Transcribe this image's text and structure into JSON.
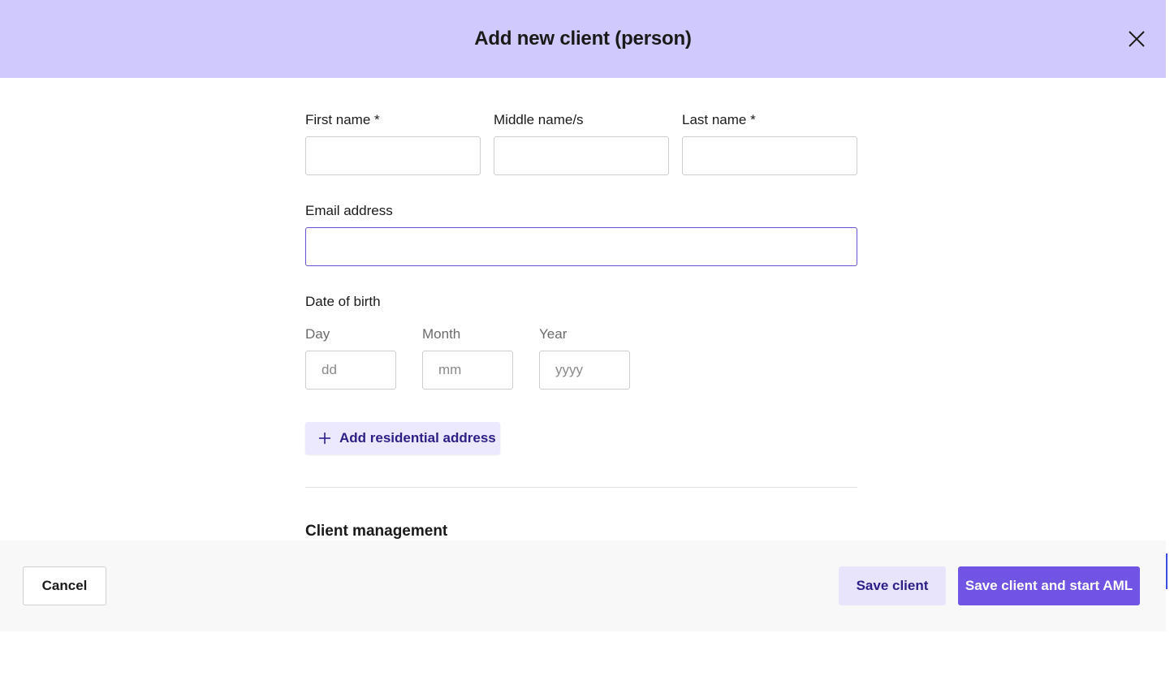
{
  "header": {
    "title": "Add new client (person)"
  },
  "fields": {
    "first_name": {
      "label": "First name *",
      "value": ""
    },
    "middle_name": {
      "label": "Middle name/s",
      "value": ""
    },
    "last_name": {
      "label": "Last name *",
      "value": ""
    },
    "email": {
      "label": "Email address",
      "value": ""
    }
  },
  "dob": {
    "label": "Date of birth",
    "day": {
      "label": "Day",
      "placeholder": "dd"
    },
    "month": {
      "label": "Month",
      "placeholder": "mm"
    },
    "year": {
      "label": "Year",
      "placeholder": "yyyy"
    }
  },
  "add_address_label": "Add residential address",
  "section": {
    "title": "Client management"
  },
  "footer": {
    "cancel_label": "Cancel",
    "save_label": "Save client",
    "save_aml_label": "Save client and start AML"
  },
  "colors": {
    "header_bg": "#d0c9fd",
    "primary": "#7154e3",
    "secondary_bg": "#e8e4fc",
    "focus_border": "#6a4fd0"
  },
  "icons": {
    "close": "close-icon",
    "add": "plus-icon"
  }
}
